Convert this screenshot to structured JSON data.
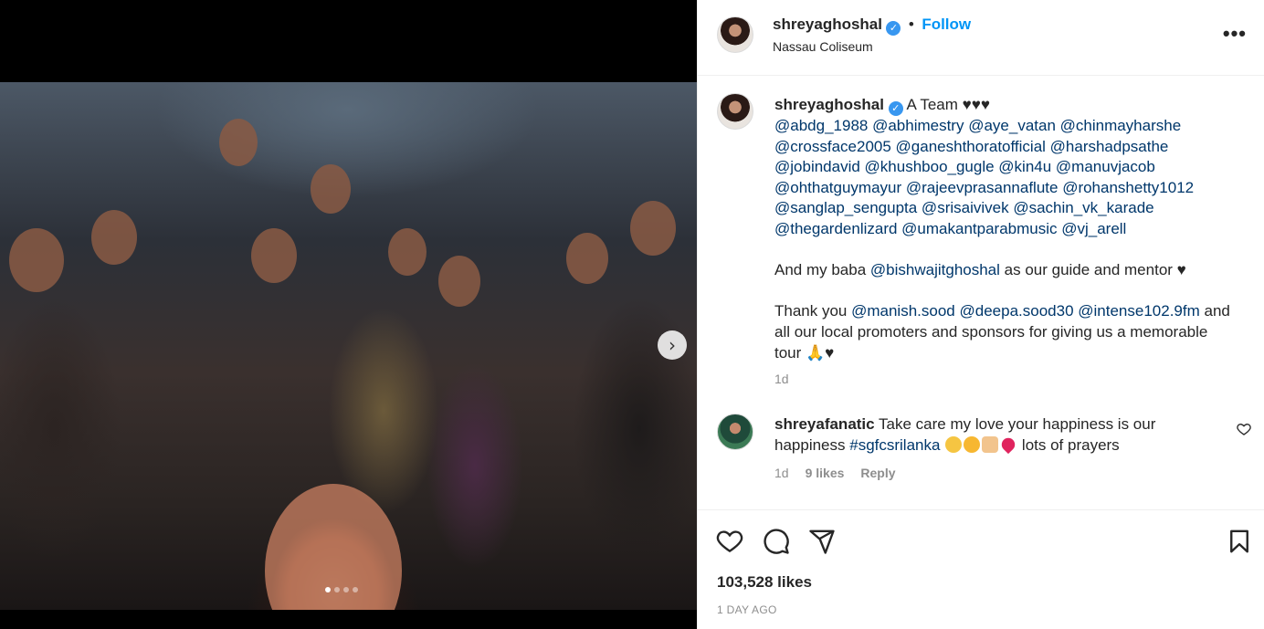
{
  "post": {
    "author": "shreyaghoshal",
    "follow_label": "Follow",
    "separator": "•",
    "location": "Nassau Coliseum",
    "more_label": "•••"
  },
  "caption": {
    "author": "shreyaghoshal",
    "intro": "A Team ♥♥♥",
    "mentions_lines": [
      "@abdg_1988 @abhimestry @aye_vatan @chinmayharshe",
      "@crossface2005 @ganeshthoratofficial @harshadpsathe",
      "@jobindavid @khushboo_gugle @kin4u @manuvjacob",
      "@ohthatguymayur @rajeevprasannaflute @rohanshetty1012",
      "@sanglap_sengupta @srisaivivek @sachin_vk_karade",
      "@thegardenlizard @umakantparabmusic @vj_arell"
    ],
    "baba_prefix": "And my baba ",
    "baba_mention": "@bishwajitghoshal",
    "baba_suffix": " as our guide and mentor ♥",
    "thanks_prefix": "Thank you ",
    "thanks_m1": "@manish.sood",
    "thanks_m2": "@deepa.sood30",
    "thanks_m3": "@intense102.9fm",
    "thanks_suffix_1": " and",
    "thanks_line2": "all our local promoters and sponsors for giving us a memorable",
    "thanks_line3": "tour 🙏♥",
    "time": "1d"
  },
  "comment": {
    "author": "shreyafanatic",
    "text_1": "Take care my love your happiness is our",
    "text_2_prefix": "happiness ",
    "hashtag": "#sgfcsrilanka",
    "text_2_suffix": " lots of prayers",
    "time": "1d",
    "likes": "9 likes",
    "reply": "Reply"
  },
  "stats": {
    "likes": "103,528 likes",
    "date": "1 DAY AGO"
  },
  "carousel": {
    "total": 4,
    "active": 0,
    "next_label": "›"
  },
  "icons": [
    "verified-badge-icon",
    "more-options-icon",
    "heart-icon",
    "comment-icon",
    "share-icon",
    "bookmark-icon",
    "carousel-next-icon"
  ],
  "colors": {
    "link": "#00376b",
    "follow": "#0095f6",
    "muted": "#8e8e8e",
    "text": "#262626"
  }
}
